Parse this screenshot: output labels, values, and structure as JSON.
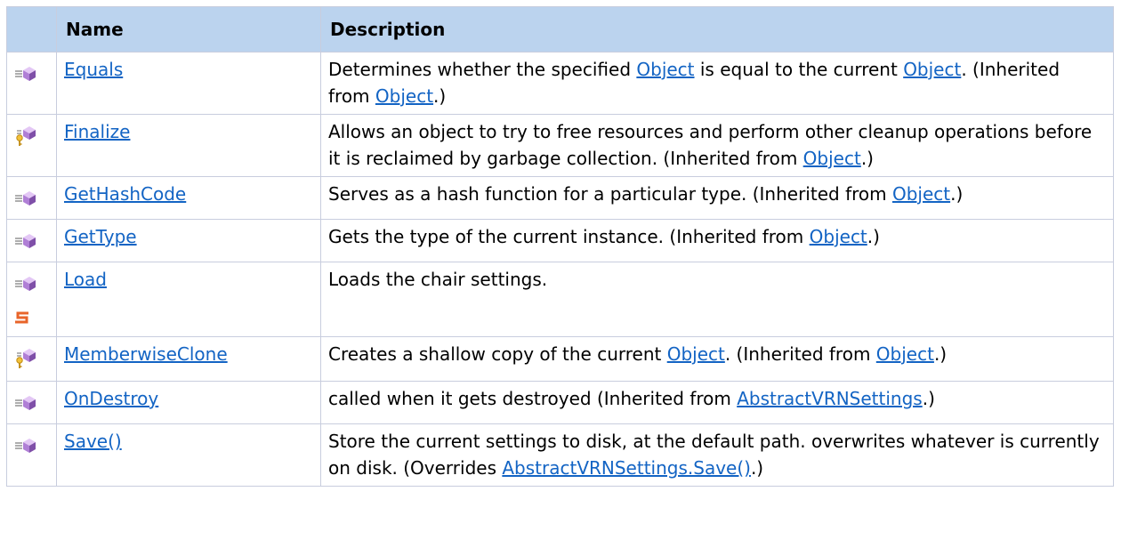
{
  "table": {
    "headers": {
      "icon": "",
      "name": "Name",
      "description": "Description"
    },
    "rows": [
      {
        "icon": "public-method-icon",
        "name": "Equals",
        "description": [
          {
            "t": "text",
            "v": "Determines whether the specified "
          },
          {
            "t": "link",
            "v": "Object"
          },
          {
            "t": "text",
            "v": " is equal to the current "
          },
          {
            "t": "link",
            "v": "Object"
          },
          {
            "t": "text",
            "v": ". (Inherited from "
          },
          {
            "t": "link",
            "v": "Object"
          },
          {
            "t": "text",
            "v": ".)"
          }
        ]
      },
      {
        "icon": "protected-method-icon",
        "name": "Finalize",
        "description": [
          {
            "t": "text",
            "v": "Allows an object to try to free resources and perform other cleanup operations before it is reclaimed by garbage collection. (Inherited from "
          },
          {
            "t": "link",
            "v": "Object"
          },
          {
            "t": "text",
            "v": ".)"
          }
        ]
      },
      {
        "icon": "public-method-icon",
        "name": "GetHashCode",
        "description": [
          {
            "t": "text",
            "v": "Serves as a hash function for a particular type. (Inherited from "
          },
          {
            "t": "link",
            "v": "Object"
          },
          {
            "t": "text",
            "v": ".)"
          }
        ]
      },
      {
        "icon": "public-method-icon",
        "name": "GetType",
        "description": [
          {
            "t": "text",
            "v": "Gets the type of the current instance. (Inherited from "
          },
          {
            "t": "link",
            "v": "Object"
          },
          {
            "t": "text",
            "v": ".)"
          }
        ]
      },
      {
        "icon": "public-method-icon",
        "static": true,
        "static_icon": "static-member-icon",
        "name": "Load",
        "description": [
          {
            "t": "text",
            "v": "Loads the chair settings."
          }
        ]
      },
      {
        "icon": "protected-method-icon",
        "name": "MemberwiseClone",
        "description": [
          {
            "t": "text",
            "v": "Creates a shallow copy of the current "
          },
          {
            "t": "link",
            "v": "Object"
          },
          {
            "t": "text",
            "v": ". (Inherited from "
          },
          {
            "t": "link",
            "v": "Object"
          },
          {
            "t": "text",
            "v": ".)"
          }
        ]
      },
      {
        "icon": "public-method-icon",
        "name": "OnDestroy",
        "description": [
          {
            "t": "text",
            "v": "called when it gets destroyed (Inherited from "
          },
          {
            "t": "link",
            "v": "AbstractVRNSettings"
          },
          {
            "t": "text",
            "v": ".)"
          }
        ]
      },
      {
        "icon": "public-method-icon",
        "name": "Save()",
        "description": [
          {
            "t": "text",
            "v": "Store the current settings to disk, at the default path. overwrites whatever is currently on disk. (Overrides "
          },
          {
            "t": "link",
            "v": "AbstractVRNSettings.Save()"
          },
          {
            "t": "text",
            "v": ".)"
          }
        ]
      }
    ]
  },
  "colors": {
    "header_bg": "#bbd3ee",
    "link": "#1364c4",
    "border": "#c8cdde",
    "method_cube": "#b07fd6",
    "static_badge": "#e8642a"
  }
}
